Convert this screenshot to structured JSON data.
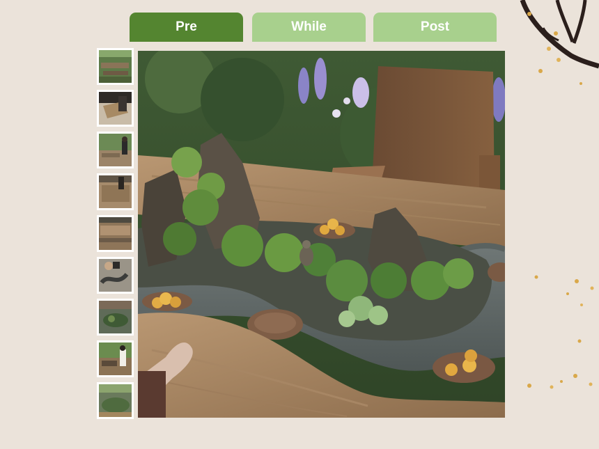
{
  "tabs": [
    {
      "label": "Pre",
      "active": true
    },
    {
      "label": "While",
      "active": false
    },
    {
      "label": "Post",
      "active": false
    }
  ],
  "colors": {
    "background": "#ebe3da",
    "tab_active": "#548530",
    "tab_inactive": "#a8d08d",
    "tab_text": "#ffffff"
  },
  "thumbnails": [
    {
      "scene": "garden-tables"
    },
    {
      "scene": "boxes-indoors"
    },
    {
      "scene": "person-at-table"
    },
    {
      "scene": "table-surface"
    },
    {
      "scene": "wood-board"
    },
    {
      "scene": "hands-shaping-bonsai"
    },
    {
      "scene": "mini-garden-closeup"
    },
    {
      "scene": "people-at-table"
    },
    {
      "scene": "mini-garden-finished"
    }
  ],
  "main_photo": {
    "scene": "miniature-rock-garden-on-wooden-table"
  },
  "decoration": {
    "icon": "tree-branch-icon"
  }
}
